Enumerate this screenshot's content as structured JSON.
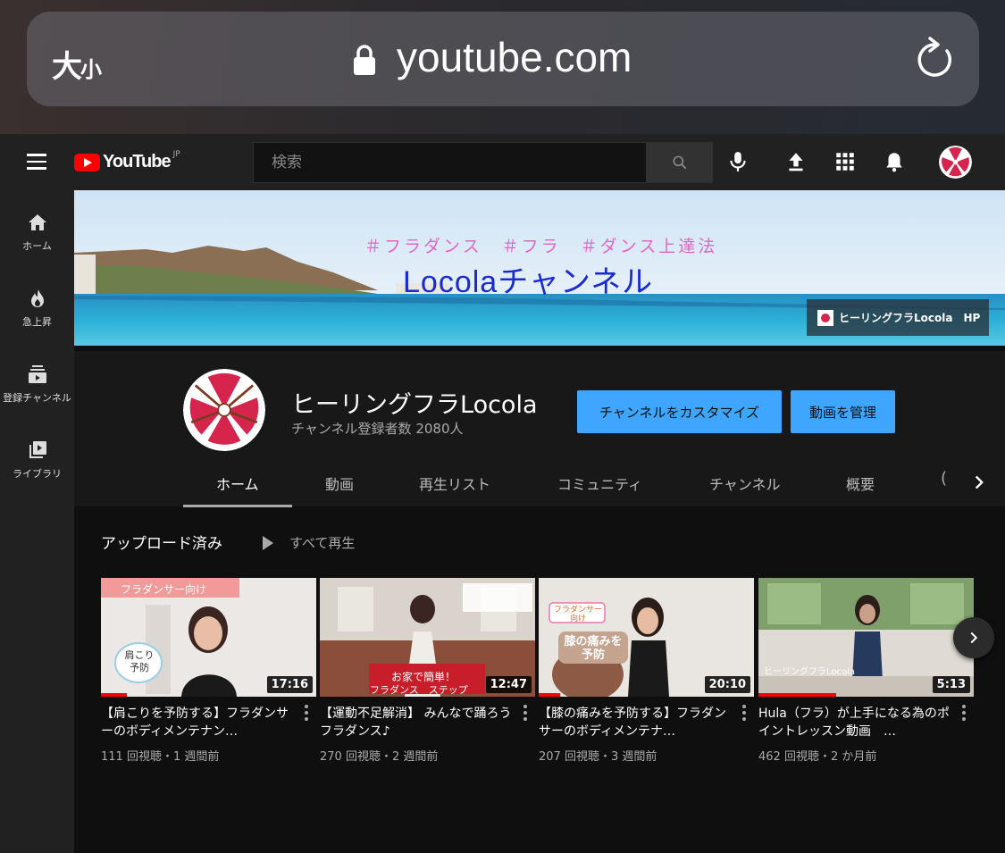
{
  "browser": {
    "text_size_large": "大",
    "text_size_small": "小",
    "url": "youtube.com",
    "icons": [
      "lock-icon",
      "reload-icon"
    ]
  },
  "header": {
    "logo_text": "YouTube",
    "logo_region": "JP",
    "search_placeholder": "検索",
    "icons": [
      "menu-icon",
      "search-icon",
      "mic-icon",
      "upload-icon",
      "apps-icon",
      "bell-icon",
      "avatar"
    ]
  },
  "guide": {
    "items": [
      {
        "label": "ホーム",
        "icon": "home-icon"
      },
      {
        "label": "急上昇",
        "icon": "flame-icon"
      },
      {
        "label": "登録チャンネル",
        "icon": "subscriptions-icon"
      },
      {
        "label": "ライブラリ",
        "icon": "library-icon"
      }
    ]
  },
  "banner": {
    "tags": "＃フラダンス　＃フラ　＃ダンス上達法",
    "title": "Locolaチャンネル",
    "link_label": "ヒーリングフラLocola",
    "link_suffix": "HP"
  },
  "channel": {
    "name": "ヒーリングフラLocola",
    "subscribers": "チャンネル登録者数 2080人",
    "customize_button": "チャンネルをカスタマイズ",
    "manage_button": "動画を管理",
    "tabs": [
      "ホーム",
      "動画",
      "再生リスト",
      "コミュニティ",
      "チャンネル",
      "概要"
    ],
    "active_tab": "ホーム",
    "partial_tab": "("
  },
  "uploads": {
    "title": "アップロード済み",
    "play_all": "すべて再生",
    "videos": [
      {
        "title": "【肩こりを予防する】フラダンサーのボディメンテナン…",
        "meta": "111 回視聴・1 週間前",
        "duration": "17:16",
        "progress": 0.12,
        "thumb_caption_top": "フラダンサー向け",
        "thumb_caption_side": "肩こり予防"
      },
      {
        "title": "【運動不足解消】 みんなで踊ろうフラダンス♪",
        "meta": "270 回視聴・2 週間前",
        "duration": "12:47",
        "progress": 0.0,
        "thumb_caption_top": "お家で簡単！",
        "thumb_caption_side": "フラダンス　ステップ"
      },
      {
        "title": "【膝の痛みを予防する】フラダンサーのボディメンテナ…",
        "meta": "207 回視聴・3 週間前",
        "duration": "20:10",
        "progress": 0.1,
        "thumb_caption_top": "フラダンサー向け",
        "thumb_caption_side": "膝の痛みを予防"
      },
      {
        "title": "Hula（フラ）が上手になる為のポイントレッスン動画　…",
        "meta": "462 回視聴・2 か月前",
        "duration": "5:13",
        "progress": 0.36,
        "thumb_caption_top": "",
        "thumb_caption_side": "ヒーリングフラLocola"
      }
    ]
  },
  "colors": {
    "accent_blue": "#3ea6ff",
    "brand_red": "#ff0000",
    "logo_pink": "#d6254c"
  }
}
